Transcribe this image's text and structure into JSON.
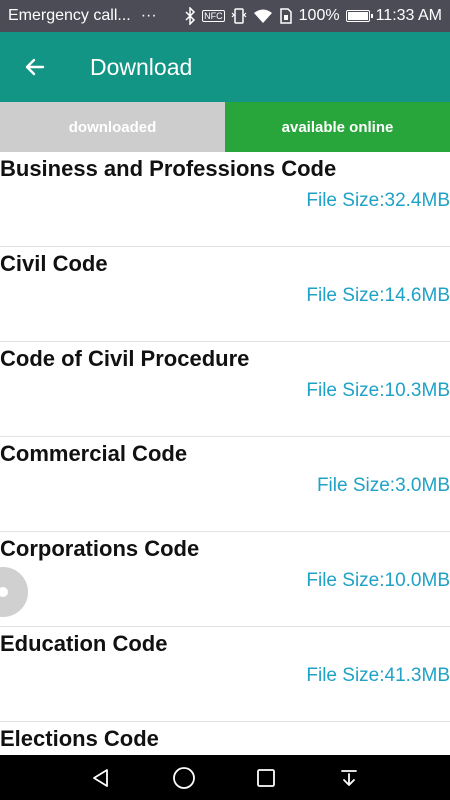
{
  "status_bar": {
    "notification_text": "Emergency call...",
    "overflow_glyph": "···",
    "battery_text": "100%",
    "battery_level": 1.0,
    "time": "11:33 AM",
    "nfc_label": "NFC",
    "icons": [
      "bluetooth-icon",
      "nfc-icon",
      "vibrate-icon",
      "wifi-icon",
      "sim-icon",
      "battery-icon"
    ]
  },
  "app_bar": {
    "title": "Download",
    "back_icon": "arrow-left-icon",
    "background": "#129584"
  },
  "tabs": [
    {
      "label": "downloaded",
      "active": false,
      "color": "#cdcdcd"
    },
    {
      "label": "available online",
      "active": true,
      "color": "#28a53b"
    }
  ],
  "downloads": [
    {
      "title": "Business and Professions Code",
      "size": "File Size:32.4MB"
    },
    {
      "title": "Civil Code",
      "size": "File Size:14.6MB"
    },
    {
      "title": "Code of Civil Procedure",
      "size": "File Size:10.3MB"
    },
    {
      "title": "Commercial Code",
      "size": "File Size:3.0MB"
    },
    {
      "title": "Corporations Code",
      "size": "File Size:10.0MB"
    },
    {
      "title": "Education Code",
      "size": "File Size:41.3MB"
    },
    {
      "title": "Elections Code",
      "size": ""
    }
  ],
  "colors": {
    "file_size_text": "#1fa2c6",
    "title_text": "#111111"
  },
  "nav_bar": {
    "icons": [
      "back-triangle-icon",
      "home-circle-icon",
      "recents-square-icon",
      "notification-pull-icon"
    ]
  }
}
